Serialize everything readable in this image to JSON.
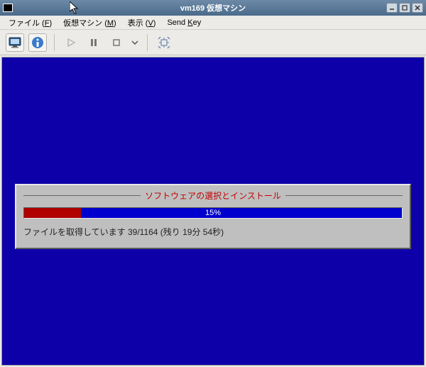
{
  "window": {
    "title": "vm169 仮想マシン"
  },
  "menubar": {
    "file": {
      "label": "ファイル",
      "mnemonic": "F"
    },
    "vm": {
      "label": "仮想マシン",
      "mnemonic": "M"
    },
    "view": {
      "label": "表示",
      "mnemonic": "V"
    },
    "sendkey": {
      "label": "Send",
      "mnemonic": "K",
      "suffix": "ey"
    }
  },
  "installer": {
    "title": "ソフトウェアの選択とインストール",
    "percent_label": "15%",
    "percent_value": 15,
    "status": "ファイルを取得しています 39/1164 (残り  19分 54秒)"
  },
  "colors": {
    "vm_bg": "#0d00a9",
    "progress_bg": "#0000ce",
    "progress_fill": "#b00000",
    "installer_title": "#c00000"
  }
}
